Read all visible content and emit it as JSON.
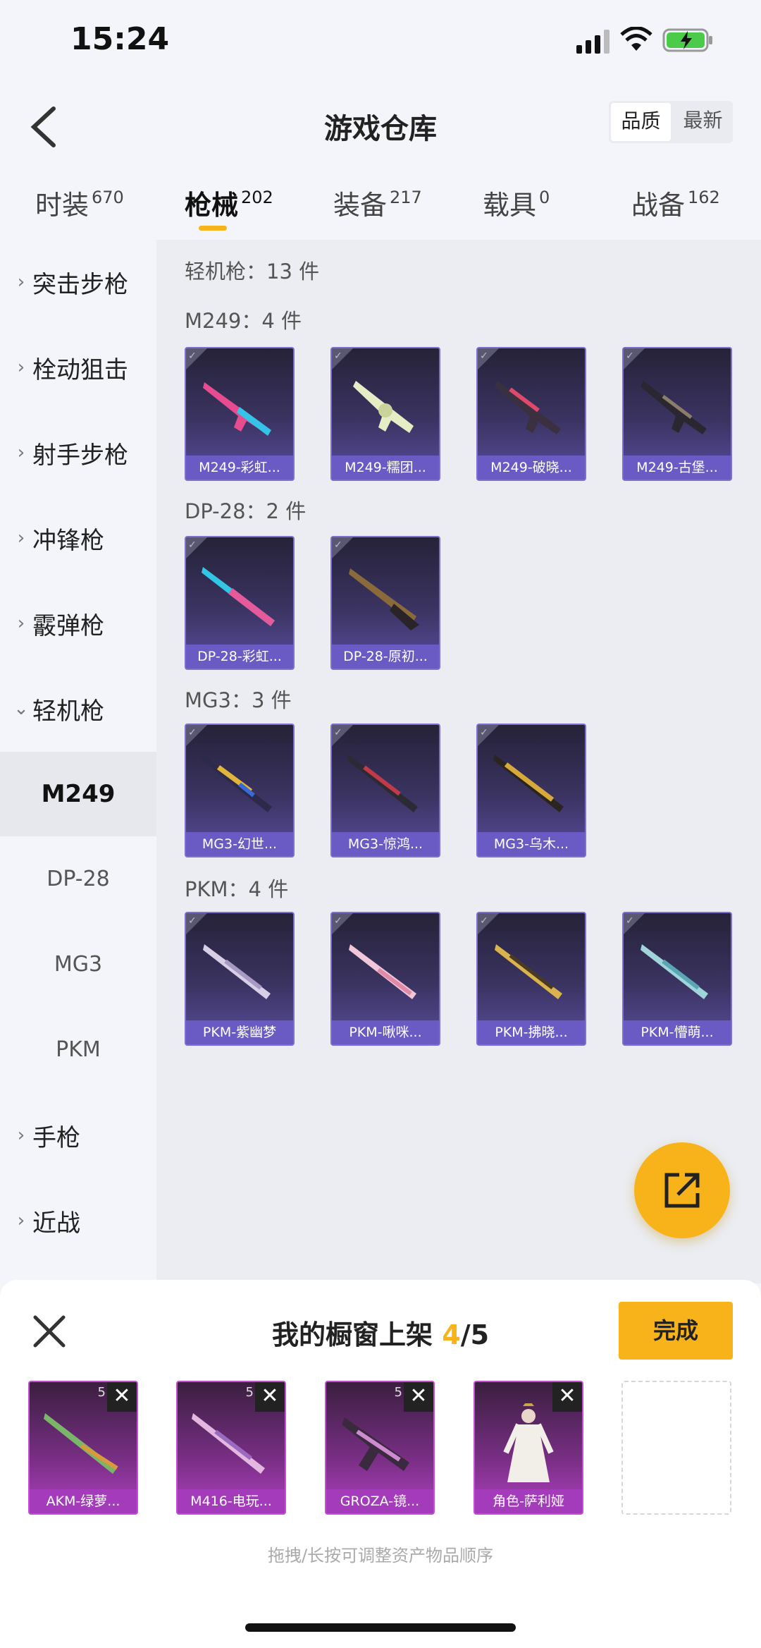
{
  "status": {
    "time": "15:24"
  },
  "header": {
    "title": "游戏仓库",
    "sort_quality": "品质",
    "sort_newest": "最新"
  },
  "tabs": [
    {
      "label": "时装",
      "count": "670"
    },
    {
      "label": "枪械",
      "count": "202"
    },
    {
      "label": "装备",
      "count": "217"
    },
    {
      "label": "载具",
      "count": "0"
    },
    {
      "label": "战备",
      "count": "162"
    }
  ],
  "sidebar": {
    "categories": [
      "突击步枪",
      "栓动狙击",
      "射手步枪",
      "冲锋枪",
      "霰弹枪",
      "轻机枪",
      "手枪",
      "近战"
    ],
    "subs": [
      "M249",
      "DP-28",
      "MG3",
      "PKM"
    ]
  },
  "content": {
    "summary": "轻机枪：13 件",
    "groups": [
      {
        "title": "M249：4 件",
        "items": [
          "M249-彩虹...",
          "M249-糯团...",
          "M249-破晓...",
          "M249-古堡..."
        ]
      },
      {
        "title": "DP-28：2 件",
        "items": [
          "DP-28-彩虹...",
          "DP-28-原初..."
        ]
      },
      {
        "title": "MG3：3 件",
        "items": [
          "MG3-幻世...",
          "MG3-惊鸿...",
          "MG3-乌木..."
        ]
      },
      {
        "title": "PKM：4 件",
        "items": [
          "PKM-紫幽梦",
          "PKM-啾咪...",
          "PKM-拂晓...",
          "PKM-懵萌..."
        ]
      }
    ]
  },
  "sheet": {
    "title_prefix": "我的橱窗上架",
    "count": "4",
    "total": "/5",
    "done_label": "完成",
    "badge": "5",
    "items": [
      "AKM-绿萝...",
      "M416-电玩...",
      "GROZA-镜...",
      "角色-萨利娅"
    ],
    "hint": "拖拽/长按可调整资产物品顺序"
  }
}
